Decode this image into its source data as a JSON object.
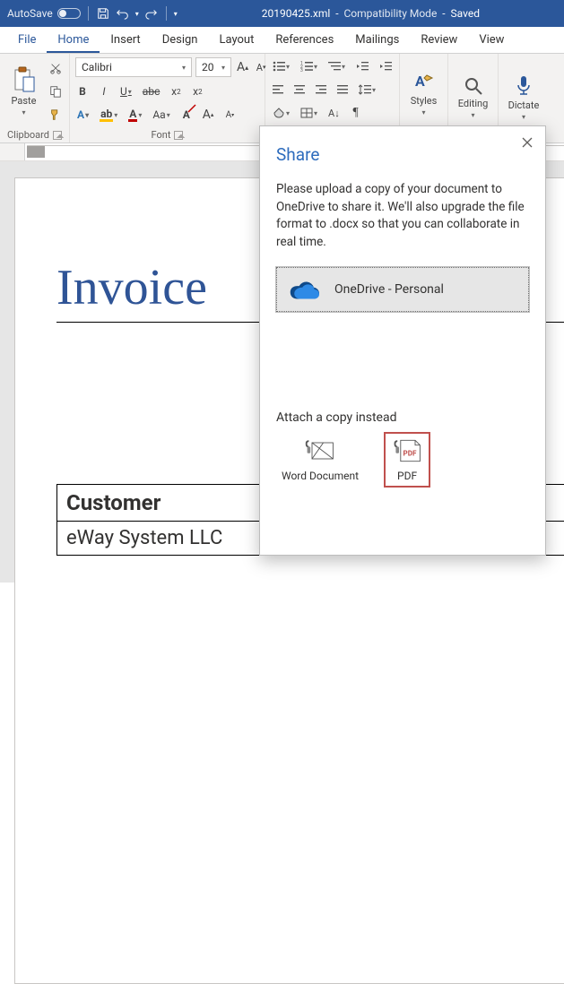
{
  "titlebar": {
    "autosave_label": "AutoSave",
    "filename": "20190425.xml",
    "mode": "Compatibility Mode",
    "save_state": "Saved"
  },
  "tabs": {
    "file": "File",
    "home": "Home",
    "insert": "Insert",
    "design": "Design",
    "layout": "Layout",
    "references": "References",
    "mailings": "Mailings",
    "review": "Review",
    "view": "View"
  },
  "ribbon": {
    "clipboard": {
      "label": "Clipboard",
      "paste": "Paste"
    },
    "font": {
      "label": "Font",
      "name": "Calibri",
      "size": "20",
      "bold": "B",
      "italic": "I",
      "underline": "U",
      "strike": "abc",
      "sub": "x",
      "sup": "x",
      "grow": "A",
      "shrink": "A",
      "case": "Aa",
      "clear": "A"
    },
    "styles": {
      "label": "Styles"
    },
    "editing": {
      "label": "Editing"
    },
    "dictate": {
      "label": "Dictate"
    }
  },
  "document": {
    "title": "Invoice",
    "customer_label": "Customer",
    "customer_value": "eWay System LLC"
  },
  "share": {
    "heading": "Share",
    "body": "Please upload a copy of your document to OneDrive to share it. We'll also upgrade the file format to .docx so that you can collaborate in real time.",
    "onedrive": "OneDrive - Personal",
    "attach_title": "Attach a copy instead",
    "word_doc": "Word Document",
    "pdf": "PDF"
  }
}
